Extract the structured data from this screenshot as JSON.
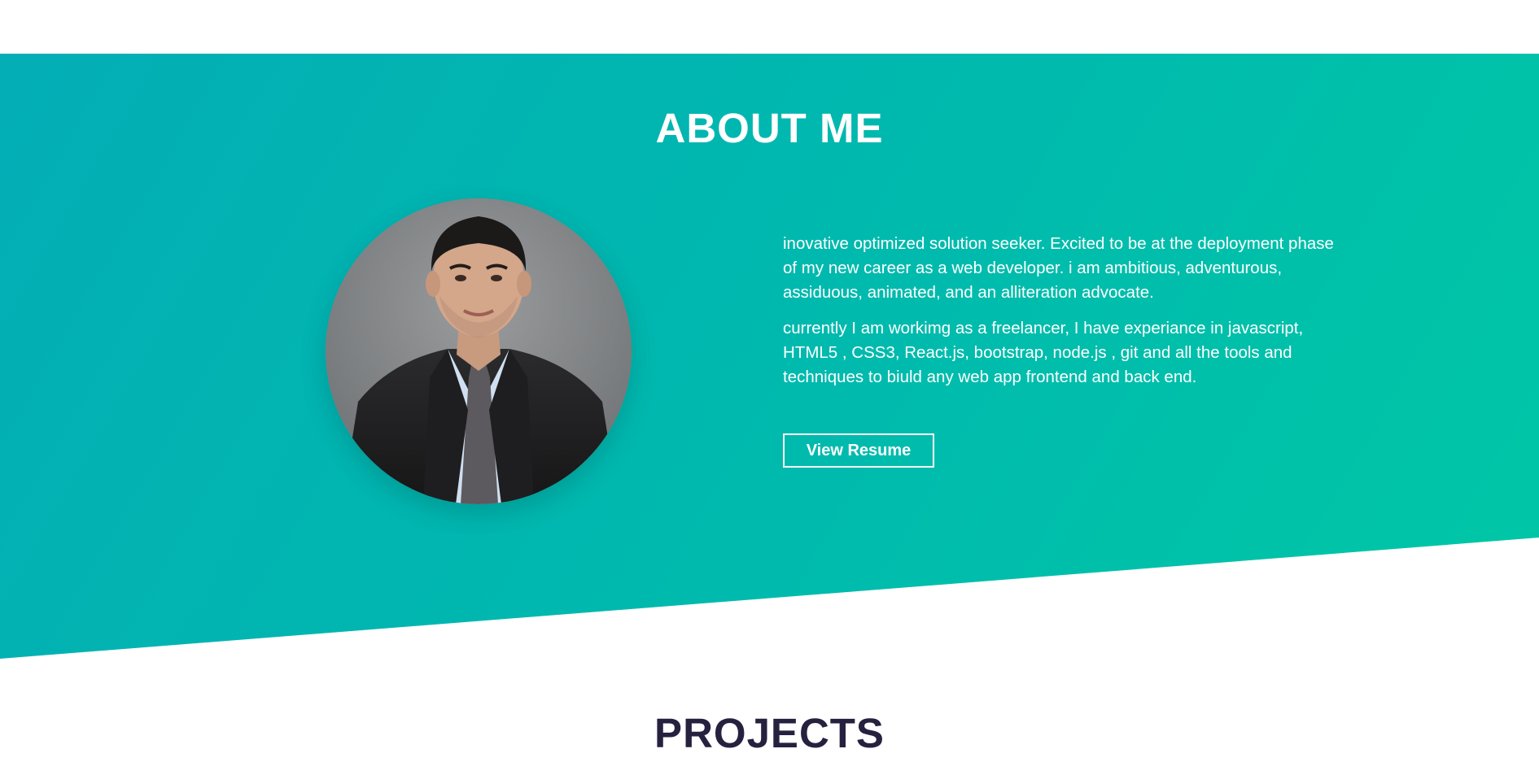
{
  "about": {
    "title": "ABOUT ME",
    "paragraphs": [
      "inovative optimized solution seeker. Excited to be at the deployment phase of my new career as a web developer. i am ambitious, adventurous, assiduous, animated, and an alliteration advocate.",
      "currently I am workimg as a freelancer, I have experiance in javascript, HTML5 , CSS3, React.js, bootstrap, node.js , git and all the tools and techniques to biuld any web app frontend and back end."
    ],
    "resume_button_label": "View Resume",
    "colors": {
      "gradient_start": "#03aeb6",
      "gradient_end": "#00c7a6",
      "text": "#ffffff"
    }
  },
  "projects": {
    "title": "PROJECTS",
    "color": "#25213f"
  }
}
